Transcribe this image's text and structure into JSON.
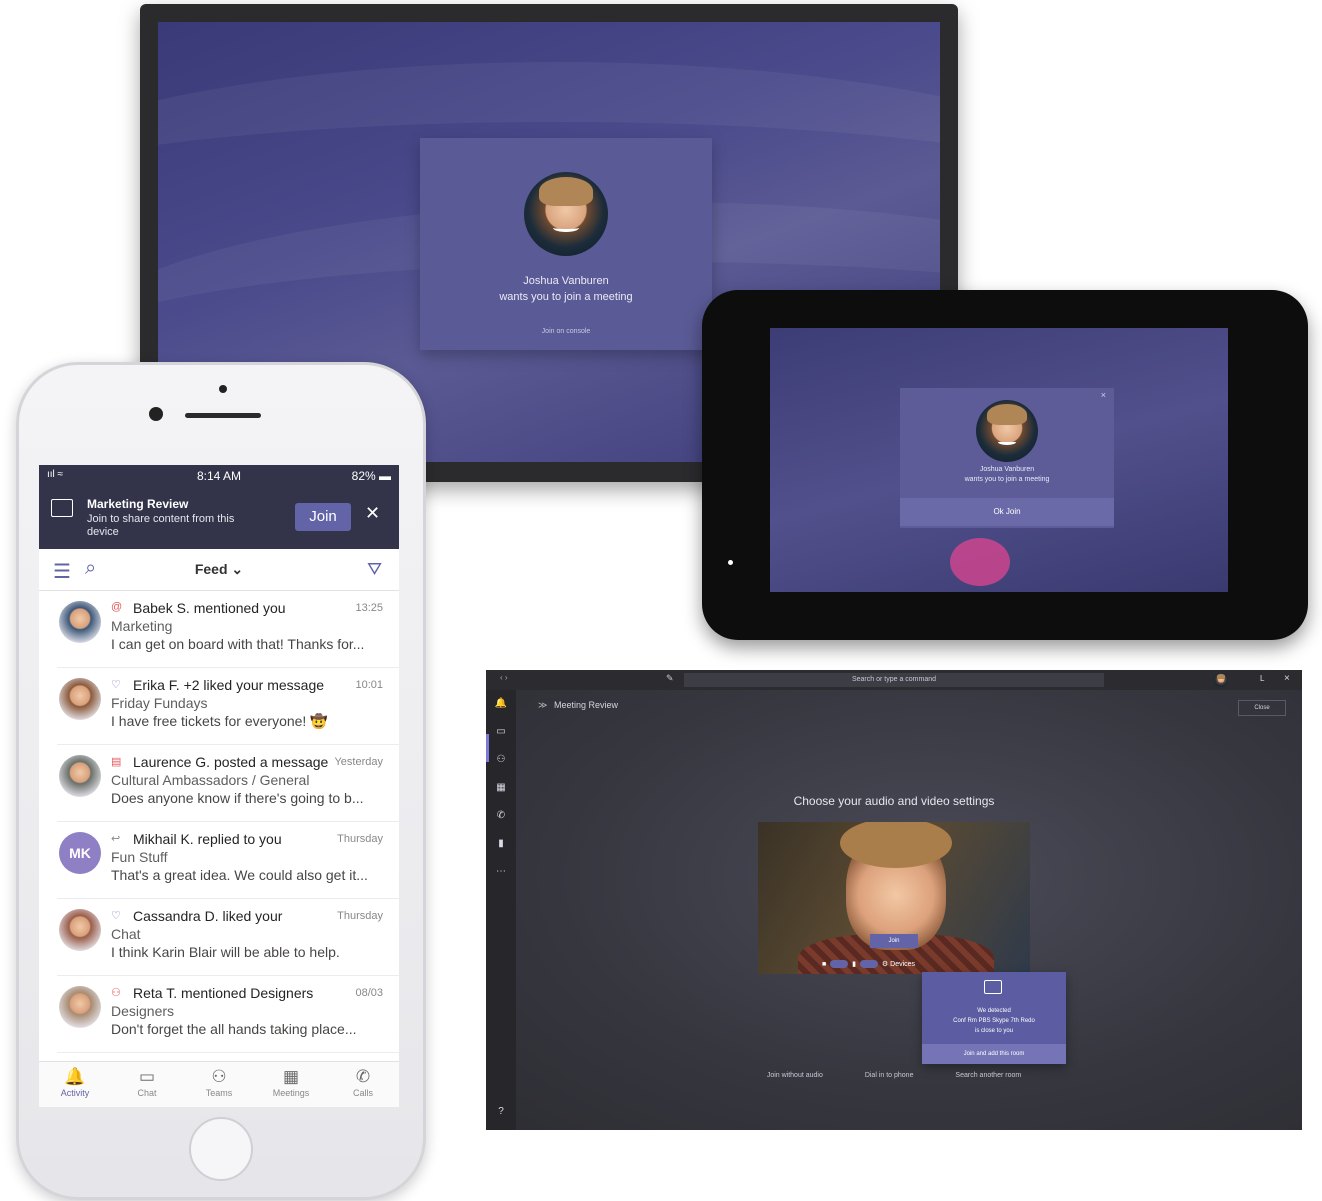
{
  "tv": {
    "caller_name": "Joshua Vanburen",
    "caller_subtitle": "wants you to join a meeting",
    "join_label": "Join on console"
  },
  "tablet": {
    "close_label": "×",
    "caller_name": "Joshua Vanburen",
    "caller_subtitle": "wants you to join a meeting",
    "join_label": "Ok Join"
  },
  "desktop": {
    "search_placeholder": "Search or type a command",
    "meeting_title": "Meeting Review",
    "close_label": "Close",
    "window_controls": [
      "L",
      "×"
    ],
    "heading": "Choose your audio and video settings",
    "video_join_label": "Join",
    "video_controls_label": "Devices",
    "popover": {
      "line1": "We detected",
      "line2": "Conf Rm PBS Skype 7th Redo",
      "line3": "is close to you",
      "button": "Join and add this room"
    },
    "options": [
      "Join without audio",
      "Dial in to phone",
      "Search another room"
    ]
  },
  "phone": {
    "status": {
      "signal": "ııl ≈",
      "time": "8:14 AM",
      "battery": "82% ▬"
    },
    "banner": {
      "title": "Marketing Review",
      "subtitle": "Join to share content from this device",
      "join_label": "Join",
      "close_label": "✕"
    },
    "toolbar": {
      "title": "Feed ⌄"
    },
    "feed": [
      {
        "icon": "@",
        "icon_color": "#e25a5a",
        "who": "Babek S. mentioned you",
        "time": "13:25",
        "channel": "Marketing",
        "message": "I can get on board with that! Thanks for...",
        "avatar_color": "#3b5677"
      },
      {
        "icon": "♡",
        "icon_color": "#8a69c9",
        "who": "Erika F. +2 liked your message",
        "time": "10:01",
        "channel": "Friday Fundays",
        "message": "I have free tickets for everyone! 🤠",
        "avatar_color": "#8a5a3c"
      },
      {
        "icon": "▤",
        "icon_color": "#e25a5a",
        "who": "Laurence G. posted a message",
        "time": "Yesterday",
        "channel": "Cultural Ambassadors / General",
        "message": "Does anyone know if there's going to b...",
        "avatar_color": "#6a6f6a"
      },
      {
        "icon": "↩",
        "icon_color": "#8a8886",
        "who": "Mikhail K. replied to you",
        "time": "Thursday",
        "channel": "Fun Stuff",
        "message": "That's a great idea. We could also get it...",
        "initials": "MK"
      },
      {
        "icon": "♡",
        "icon_color": "#8a69c9",
        "who": "Cassandra D. liked your",
        "time": "Thursday",
        "channel": "Chat",
        "message": "I think Karin Blair will be able to help.",
        "avatar_color": "#9a5d4a"
      },
      {
        "icon": "⚇",
        "icon_color": "#e25a5a",
        "who": "Reta T. mentioned Designers",
        "time": "08/03",
        "channel": "Designers",
        "message": "Don't forget the all hands taking place...",
        "avatar_color": "#a88a72"
      }
    ],
    "tabs": [
      {
        "label": "Activity",
        "glyph": "🔔"
      },
      {
        "label": "Chat",
        "glyph": "▭"
      },
      {
        "label": "Teams",
        "glyph": "⚇"
      },
      {
        "label": "Meetings",
        "glyph": "▦"
      },
      {
        "label": "Calls",
        "glyph": "✆"
      }
    ]
  }
}
